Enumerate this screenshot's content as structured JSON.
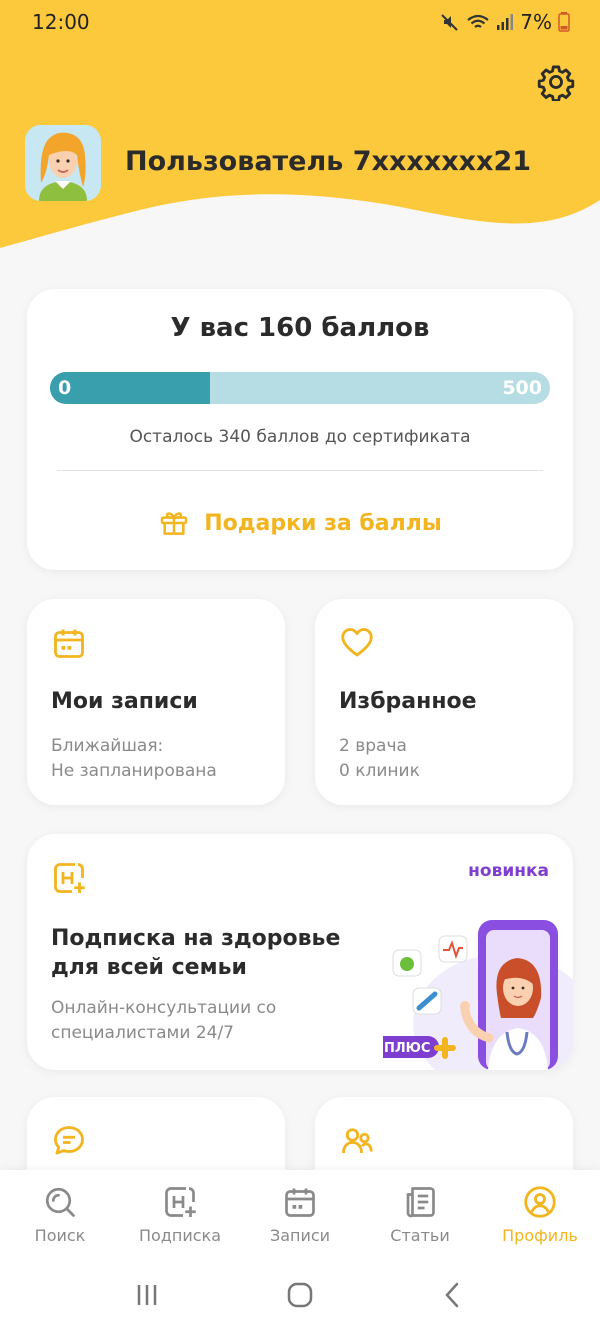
{
  "status_bar": {
    "time": "12:00",
    "battery": "7%"
  },
  "profile": {
    "username": "Пользователь 7xxxxxxx21"
  },
  "points": {
    "title": "У вас 160 баллов",
    "progress": {
      "min_label": "0",
      "max_label": "500",
      "current": 160,
      "max": 500
    },
    "remaining": "Осталось 340 баллов до сертификата",
    "gifts_label": "Подарки за баллы"
  },
  "appointments": {
    "title": "Мои записи",
    "line1": "Ближайшая:",
    "line2": "Не запланирована"
  },
  "favorites": {
    "title": "Избранное",
    "line1": "2 врача",
    "line2": "0 клиник"
  },
  "subscription": {
    "badge": "новинка",
    "title": "Подписка на здоровье для всей семьи",
    "description": "Онлайн-консультации со специалистами 24/7",
    "plus_label": "ПЛЮС"
  },
  "bottom_nav": [
    {
      "label": "Поиск",
      "icon": "search-icon"
    },
    {
      "label": "Подписка",
      "icon": "subscription-icon"
    },
    {
      "label": "Записи",
      "icon": "calendar-icon"
    },
    {
      "label": "Статьи",
      "icon": "articles-icon"
    },
    {
      "label": "Профиль",
      "icon": "profile-icon"
    }
  ],
  "colors": {
    "accent": "#f3b51f",
    "header": "#fdc93c",
    "progress_fill": "#3a9fac",
    "progress_track": "#b6dde3",
    "badge": "#7e3fd0"
  }
}
